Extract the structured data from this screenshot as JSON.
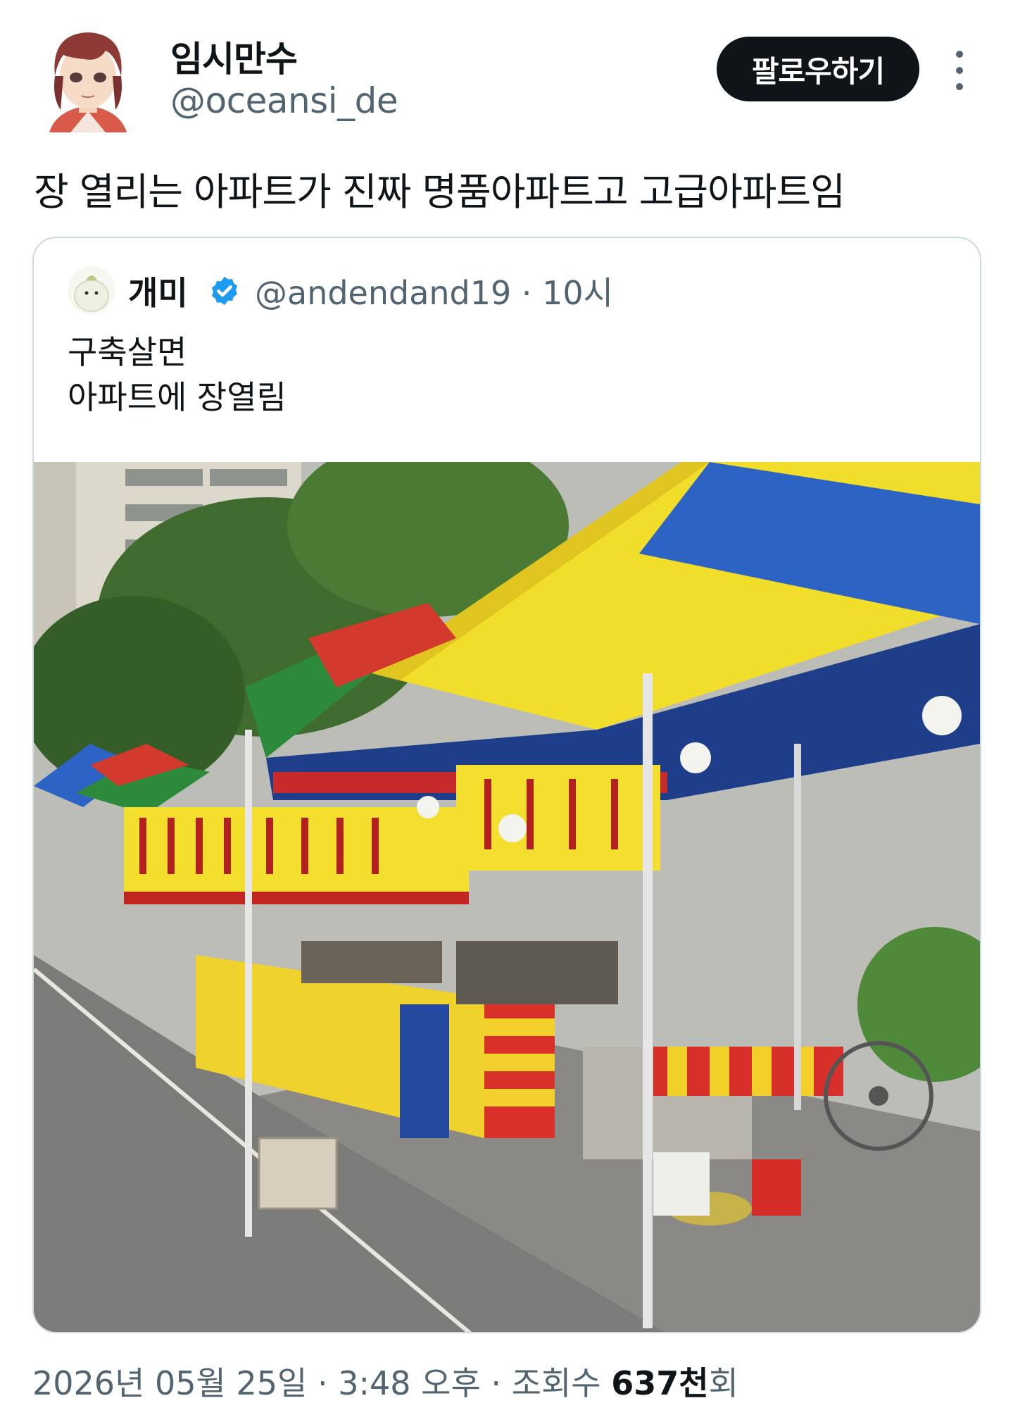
{
  "author": {
    "display_name": "임시만수",
    "handle": "@oceansi_de"
  },
  "follow_label": "팔로우하기",
  "tweet_text": "장 열리는 아파트가 진짜 명품아파트고 고급아파트임",
  "quoted": {
    "display_name": "개미",
    "handle_time": "@andendand19 · 10시",
    "lines": [
      "구축살면",
      "아파트에 장열림"
    ]
  },
  "meta": {
    "date_time": "2026년 05월 25일 · 3:48 오후 · 조회수 ",
    "views": "637천",
    "views_suffix": "회"
  },
  "colors": {
    "follow_bg": "#0f1419",
    "verified": "#1d9bf0",
    "secondary_text": "#536471",
    "border": "#cfd9de"
  },
  "icons": {
    "more": "more-vertical-icon",
    "verified": "verified-badge-icon"
  }
}
